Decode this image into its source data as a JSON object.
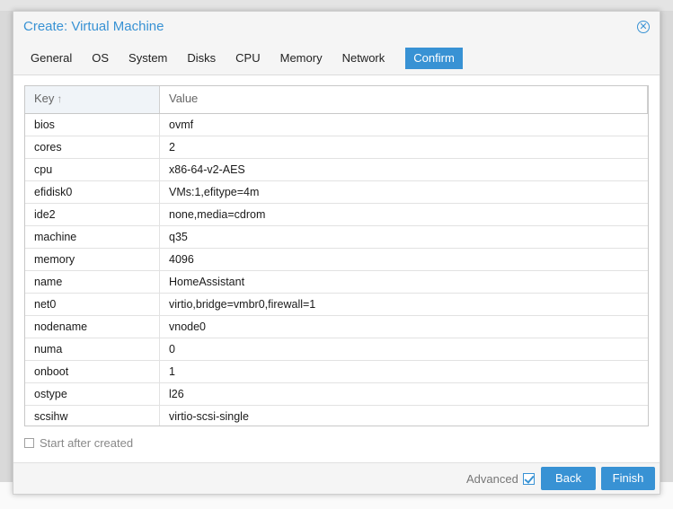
{
  "window": {
    "title": "Create: Virtual Machine"
  },
  "tabs": [
    {
      "label": "General"
    },
    {
      "label": "OS"
    },
    {
      "label": "System"
    },
    {
      "label": "Disks"
    },
    {
      "label": "CPU"
    },
    {
      "label": "Memory"
    },
    {
      "label": "Network"
    },
    {
      "label": "Confirm",
      "active": true
    }
  ],
  "grid": {
    "columns": {
      "key": "Key",
      "value": "Value",
      "sort_indicator": "↑"
    },
    "rows": [
      {
        "key": "bios",
        "value": "ovmf"
      },
      {
        "key": "cores",
        "value": "2"
      },
      {
        "key": "cpu",
        "value": "x86-64-v2-AES"
      },
      {
        "key": "efidisk0",
        "value": "VMs:1,efitype=4m"
      },
      {
        "key": "ide2",
        "value": "none,media=cdrom"
      },
      {
        "key": "machine",
        "value": "q35"
      },
      {
        "key": "memory",
        "value": "4096"
      },
      {
        "key": "name",
        "value": "HomeAssistant"
      },
      {
        "key": "net0",
        "value": "virtio,bridge=vmbr0,firewall=1"
      },
      {
        "key": "nodename",
        "value": "vnode0"
      },
      {
        "key": "numa",
        "value": "0"
      },
      {
        "key": "onboot",
        "value": "1"
      },
      {
        "key": "ostype",
        "value": "l26"
      },
      {
        "key": "scsihw",
        "value": "virtio-scsi-single"
      }
    ]
  },
  "options": {
    "start_after_created": {
      "label": "Start after created",
      "checked": false
    }
  },
  "footer": {
    "advanced_label": "Advanced",
    "advanced_checked": true,
    "back_label": "Back",
    "finish_label": "Finish"
  },
  "colors": {
    "accent": "#3892d4"
  }
}
